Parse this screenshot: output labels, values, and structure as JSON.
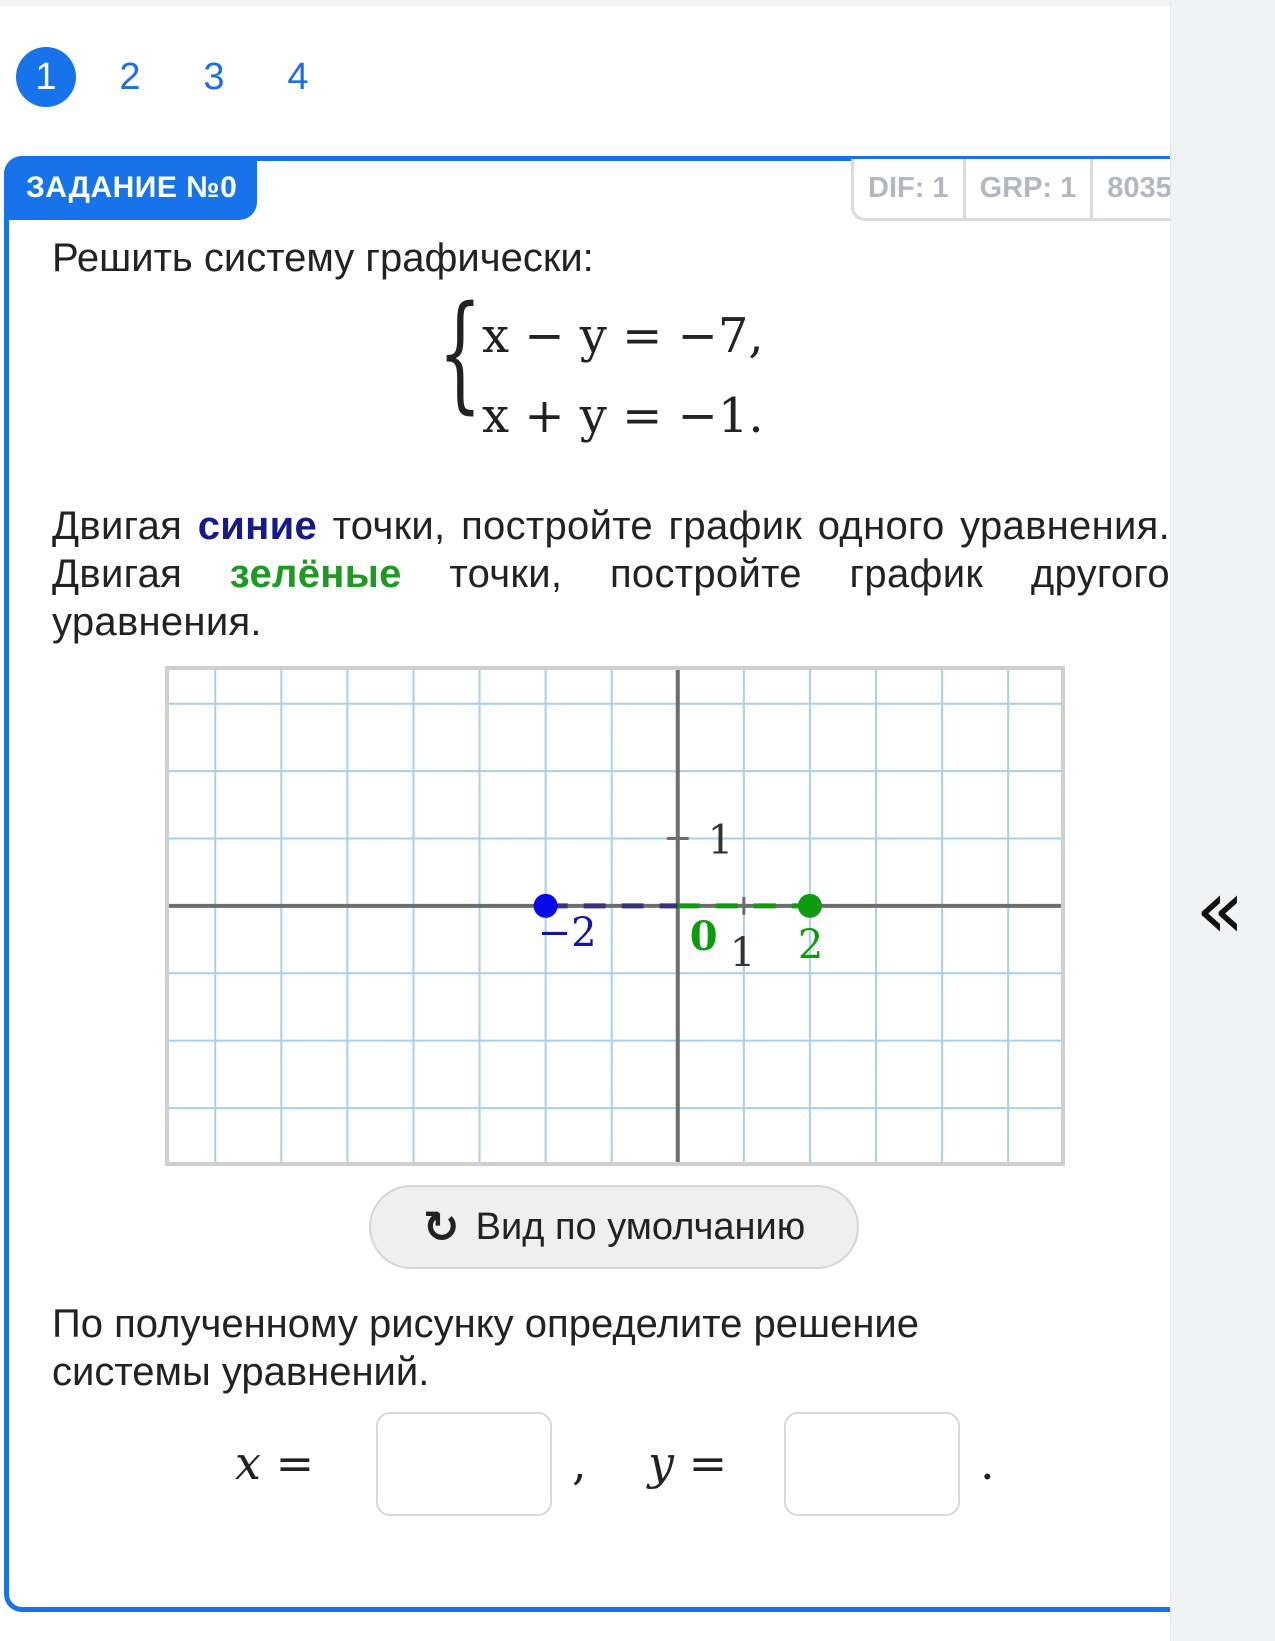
{
  "pager": {
    "pages": [
      "1",
      "2",
      "3",
      "4"
    ],
    "active": 0
  },
  "task": {
    "label": "ЗАДАНИЕ №0",
    "tags": [
      "DIF: 1",
      "GRP: 1",
      "8035"
    ],
    "title": "Решить систему графически:",
    "equations": [
      "x − y = −7,",
      "x + y = −1."
    ],
    "instruction": {
      "p1": "Двигая",
      "blue_word": "синие",
      "p2": "точки, постройте график одного уравнения. Двигая",
      "green_word": "зелёные",
      "p3": "точки, постройте график другого уравнения."
    },
    "reset_label": "Вид по умолчанию",
    "question": "По полученному рисунку определите решение системы уравнений.",
    "answer": {
      "x_label": "x =",
      "y_label": "y =",
      "separator": ",",
      "end": ".",
      "x_value": "",
      "y_value": ""
    }
  },
  "graph": {
    "x_range": [
      -7.7,
      5.8
    ],
    "y_range": [
      -3.8,
      3.5
    ],
    "tick_labels": {
      "x_one": "1",
      "y_one": "1"
    },
    "blue_points": [
      {
        "x": -2,
        "y": 0,
        "label": "−2"
      },
      {
        "x": 0,
        "y": 0,
        "label": ""
      }
    ],
    "green_points": [
      {
        "x": 0,
        "y": 0,
        "label": "0"
      },
      {
        "x": 2,
        "y": 0,
        "label": "2"
      }
    ],
    "colors": {
      "blue": "#0a0ae6",
      "green": "#0f9a0f",
      "axis": "#6d6d6d",
      "grid": "#a9cfee"
    }
  },
  "icons": {
    "reset": "refresh-icon",
    "collapse": "double-chevron-left-icon"
  }
}
